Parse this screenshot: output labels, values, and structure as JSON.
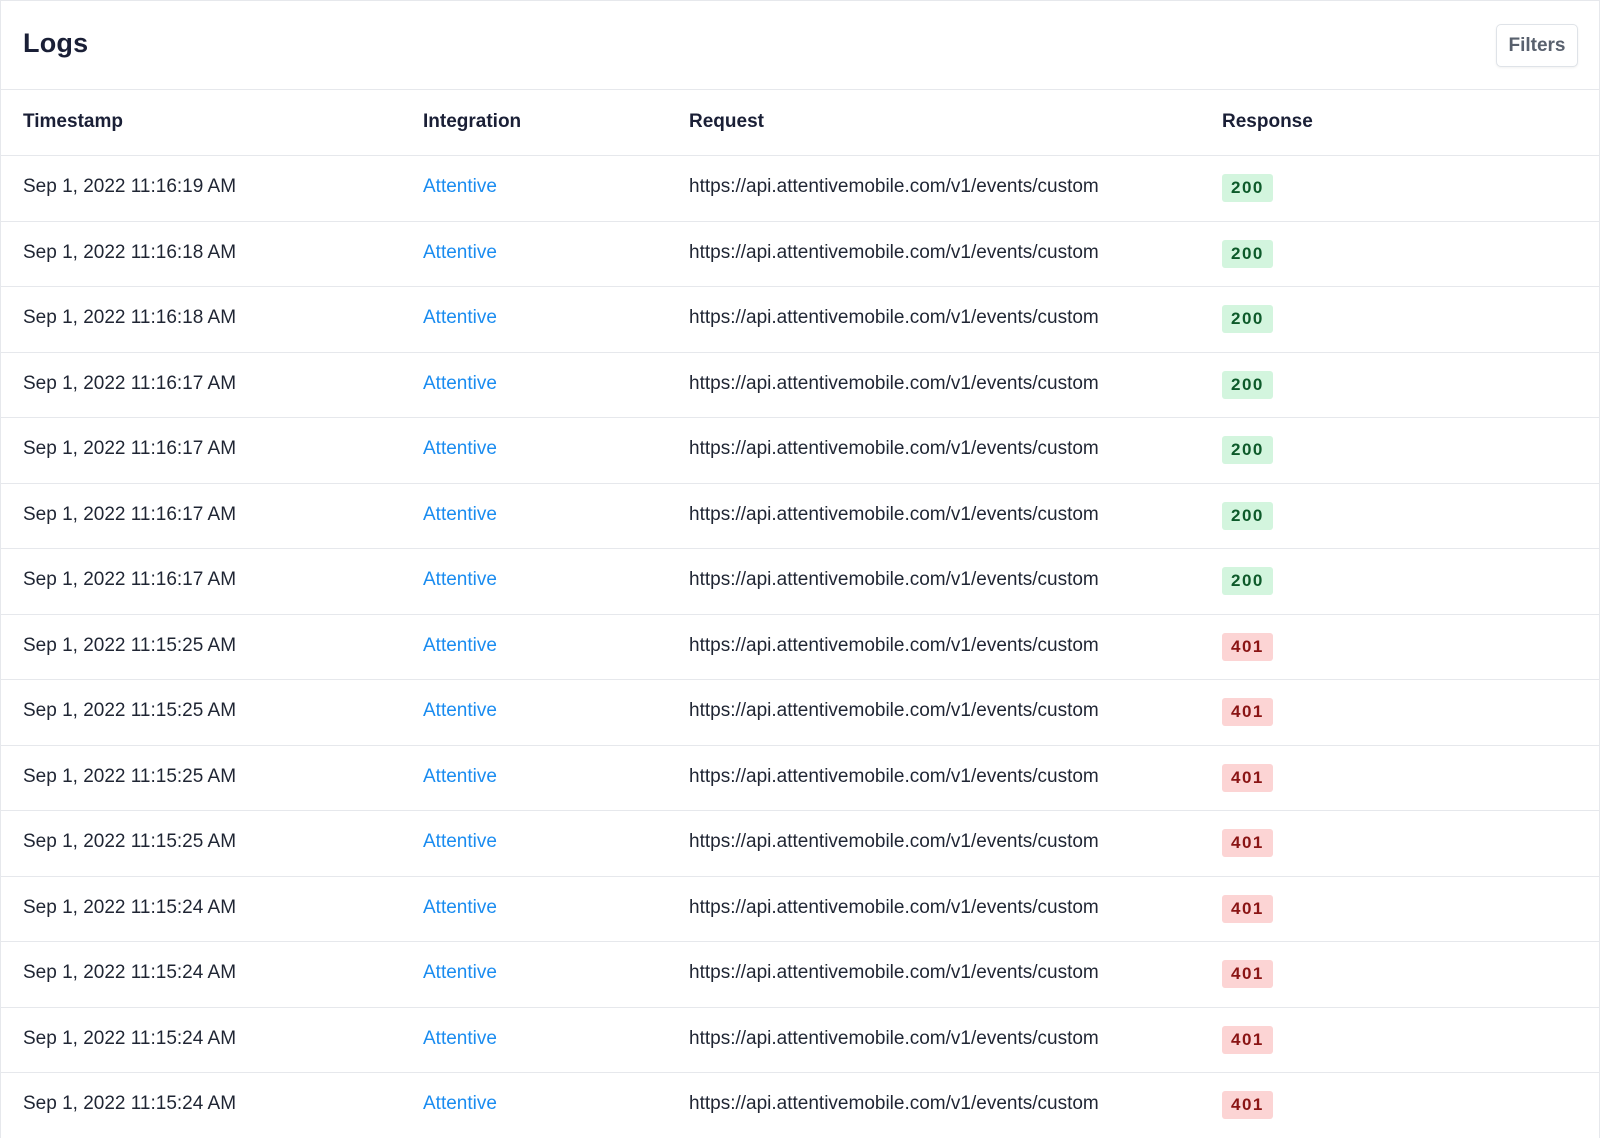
{
  "header": {
    "title": "Logs",
    "filters_label": "Filters"
  },
  "table": {
    "columns": [
      "Timestamp",
      "Integration",
      "Request",
      "Response"
    ],
    "rows": [
      {
        "timestamp": "Sep 1, 2022 11:16:19 AM",
        "integration": "Attentive",
        "request": "https://api.attentivemobile.com/v1/events/custom",
        "response": "200",
        "status": "success"
      },
      {
        "timestamp": "Sep 1, 2022 11:16:18 AM",
        "integration": "Attentive",
        "request": "https://api.attentivemobile.com/v1/events/custom",
        "response": "200",
        "status": "success"
      },
      {
        "timestamp": "Sep 1, 2022 11:16:18 AM",
        "integration": "Attentive",
        "request": "https://api.attentivemobile.com/v1/events/custom",
        "response": "200",
        "status": "success"
      },
      {
        "timestamp": "Sep 1, 2022 11:16:17 AM",
        "integration": "Attentive",
        "request": "https://api.attentivemobile.com/v1/events/custom",
        "response": "200",
        "status": "success"
      },
      {
        "timestamp": "Sep 1, 2022 11:16:17 AM",
        "integration": "Attentive",
        "request": "https://api.attentivemobile.com/v1/events/custom",
        "response": "200",
        "status": "success"
      },
      {
        "timestamp": "Sep 1, 2022 11:16:17 AM",
        "integration": "Attentive",
        "request": "https://api.attentivemobile.com/v1/events/custom",
        "response": "200",
        "status": "success"
      },
      {
        "timestamp": "Sep 1, 2022 11:16:17 AM",
        "integration": "Attentive",
        "request": "https://api.attentivemobile.com/v1/events/custom",
        "response": "200",
        "status": "success"
      },
      {
        "timestamp": "Sep 1, 2022 11:15:25 AM",
        "integration": "Attentive",
        "request": "https://api.attentivemobile.com/v1/events/custom",
        "response": "401",
        "status": "error"
      },
      {
        "timestamp": "Sep 1, 2022 11:15:25 AM",
        "integration": "Attentive",
        "request": "https://api.attentivemobile.com/v1/events/custom",
        "response": "401",
        "status": "error"
      },
      {
        "timestamp": "Sep 1, 2022 11:15:25 AM",
        "integration": "Attentive",
        "request": "https://api.attentivemobile.com/v1/events/custom",
        "response": "401",
        "status": "error"
      },
      {
        "timestamp": "Sep 1, 2022 11:15:25 AM",
        "integration": "Attentive",
        "request": "https://api.attentivemobile.com/v1/events/custom",
        "response": "401",
        "status": "error"
      },
      {
        "timestamp": "Sep 1, 2022 11:15:24 AM",
        "integration": "Attentive",
        "request": "https://api.attentivemobile.com/v1/events/custom",
        "response": "401",
        "status": "error"
      },
      {
        "timestamp": "Sep 1, 2022 11:15:24 AM",
        "integration": "Attentive",
        "request": "https://api.attentivemobile.com/v1/events/custom",
        "response": "401",
        "status": "error"
      },
      {
        "timestamp": "Sep 1, 2022 11:15:24 AM",
        "integration": "Attentive",
        "request": "https://api.attentivemobile.com/v1/events/custom",
        "response": "401",
        "status": "error"
      },
      {
        "timestamp": "Sep 1, 2022 11:15:24 AM",
        "integration": "Attentive",
        "request": "https://api.attentivemobile.com/v1/events/custom",
        "response": "401",
        "status": "error"
      }
    ]
  },
  "colors": {
    "link": "#1a8cf0",
    "success_bg": "#d3f5de",
    "success_text": "#0d5a2a",
    "error_bg": "#fcd4d4",
    "error_text": "#8a1414",
    "border": "#e6e8ec"
  }
}
